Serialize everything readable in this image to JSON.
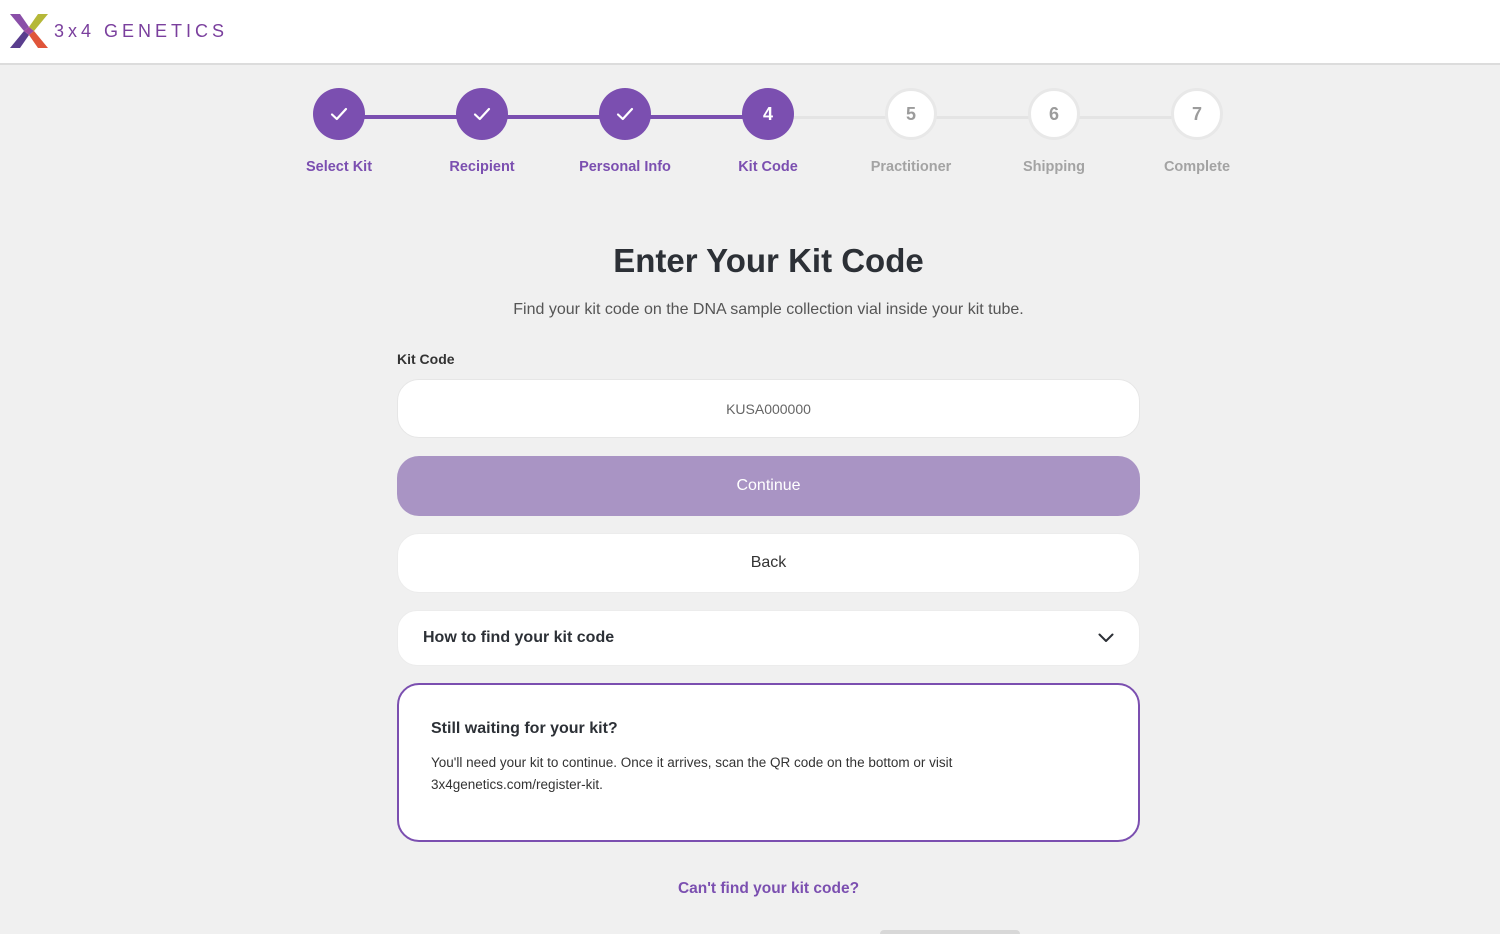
{
  "brand": {
    "name": "3x4 GENETICS"
  },
  "colors": {
    "accent": "#7b4fb0",
    "accent_light": "#a994c4",
    "inactive": "#a3a3a3"
  },
  "stepper": {
    "steps": [
      {
        "label": "Select Kit",
        "state": "done",
        "number": "1"
      },
      {
        "label": "Recipient",
        "state": "done",
        "number": "2"
      },
      {
        "label": "Personal Info",
        "state": "done",
        "number": "3"
      },
      {
        "label": "Kit Code",
        "state": "active",
        "number": "4"
      },
      {
        "label": "Practitioner",
        "state": "todo",
        "number": "5"
      },
      {
        "label": "Shipping",
        "state": "todo",
        "number": "6"
      },
      {
        "label": "Complete",
        "state": "todo",
        "number": "7"
      }
    ]
  },
  "main": {
    "title": "Enter Your Kit Code",
    "subtitle": "Find your kit code on the DNA sample collection vial inside your kit tube.",
    "kit_code_label": "Kit Code",
    "kit_code_placeholder": "KUSA000000",
    "kit_code_value": "",
    "continue_label": "Continue",
    "back_label": "Back",
    "accordion_label": "How to find your kit code",
    "accordion_icon": "chevron-down-icon",
    "info_title": "Still waiting for your kit?",
    "info_body": "You'll need your kit to continue. Once it arrives, scan the QR code on the bottom or visit 3x4genetics.com/register-kit.",
    "help_link": "Can't find your kit code?"
  }
}
